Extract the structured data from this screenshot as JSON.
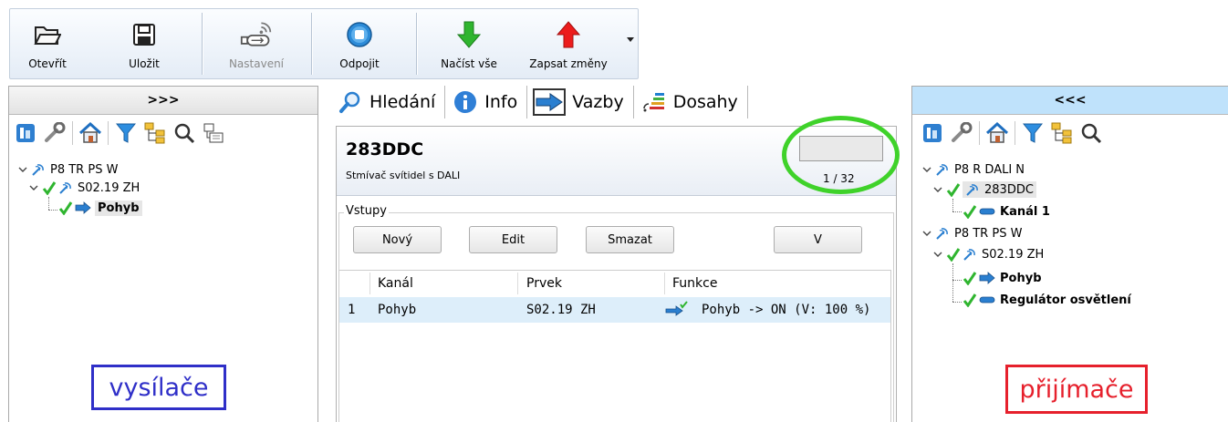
{
  "toolbar": {
    "buttons": [
      {
        "label": "Otevřít",
        "icon": "folder-open-icon",
        "enabled": true
      },
      {
        "label": "Uložit",
        "icon": "floppy-disk-icon",
        "enabled": true
      },
      {
        "label": "Nastavení",
        "icon": "usb-wireless-icon",
        "enabled": false
      },
      {
        "label": "Odpojit",
        "icon": "disconnect-stop-icon",
        "enabled": true
      },
      {
        "label": "Načíst vše",
        "icon": "green-down-arrow-icon",
        "enabled": true
      },
      {
        "label": "Zapsat změny",
        "icon": "red-up-arrow-icon",
        "enabled": true
      }
    ]
  },
  "left_panel": {
    "header": ">>>",
    "icons": [
      "module-icon",
      "wrench-icon",
      "house-icon",
      "filter-icon",
      "hierarchy-icon",
      "search-icon",
      "export-icon"
    ],
    "tree": [
      {
        "label": "P8 TR PS W",
        "level": 0,
        "expanded": true,
        "checked": false,
        "icon": "antenna-icon"
      },
      {
        "label": "S02.19 ZH",
        "level": 1,
        "expanded": true,
        "checked": true,
        "icon": "antenna-icon"
      },
      {
        "label": "Pohyb",
        "level": 2,
        "checked": true,
        "icon": "arrow-right-icon",
        "bold": true
      }
    ],
    "badge": "vysílače"
  },
  "tabs": [
    {
      "label": "Hledání",
      "icon": "search-person-icon",
      "active": false
    },
    {
      "label": "Info",
      "icon": "info-icon",
      "active": false
    },
    {
      "label": "Vazby",
      "icon": "arrow-right-icon",
      "active": true
    },
    {
      "label": "Dosahy",
      "icon": "signal-range-icon",
      "active": false
    }
  ],
  "device": {
    "name": "283DDC",
    "description": "Stmívač svítidel s DALI",
    "page_indicator": "1 / 32",
    "progress": 0.0
  },
  "inputs": {
    "group_title": "Vstupy",
    "buttons": [
      "Nový",
      "Edit",
      "Smazat",
      "V"
    ],
    "columns": [
      "Kanál",
      "Prvek",
      "Funkce"
    ],
    "rows": [
      {
        "index": "1",
        "kanal": "Pohyb",
        "prvek": "S02.19 ZH",
        "funkce": "Pohyb -> ON (V: 100 %)"
      }
    ]
  },
  "right_panel": {
    "header": "<<<",
    "icons": [
      "module-icon",
      "wrench-icon",
      "house-icon",
      "filter-icon",
      "hierarchy-icon",
      "search-icon"
    ],
    "tree": [
      {
        "label": "P8 R DALI N",
        "level": 0,
        "expanded": true,
        "icon": "antenna-icon"
      },
      {
        "label": "283DDC",
        "level": 1,
        "expanded": true,
        "checked": true,
        "icon": "antenna-icon",
        "selected": true
      },
      {
        "label": "Kanál 1",
        "level": 2,
        "checked": true,
        "icon": "blue-bar-icon",
        "bold": true
      },
      {
        "label": "P8 TR PS W",
        "level": 0,
        "expanded": true,
        "icon": "antenna-icon"
      },
      {
        "label": "S02.19 ZH",
        "level": 1,
        "expanded": true,
        "checked": true,
        "icon": "antenna-icon"
      },
      {
        "label": "Pohyb",
        "level": 2,
        "checked": true,
        "icon": "arrow-right-icon",
        "bold": true
      },
      {
        "label": "Regulátor osvětlení",
        "level": 2,
        "checked": true,
        "icon": "blue-bar-icon",
        "bold": true
      }
    ],
    "badge": "přijímače"
  },
  "colors": {
    "accent_green": "#3fd22a",
    "badge_blue": "#2f2fc8",
    "badge_red": "#e6202c",
    "right_header": "#bfe2fb",
    "selected_row": "#ddeefa"
  }
}
